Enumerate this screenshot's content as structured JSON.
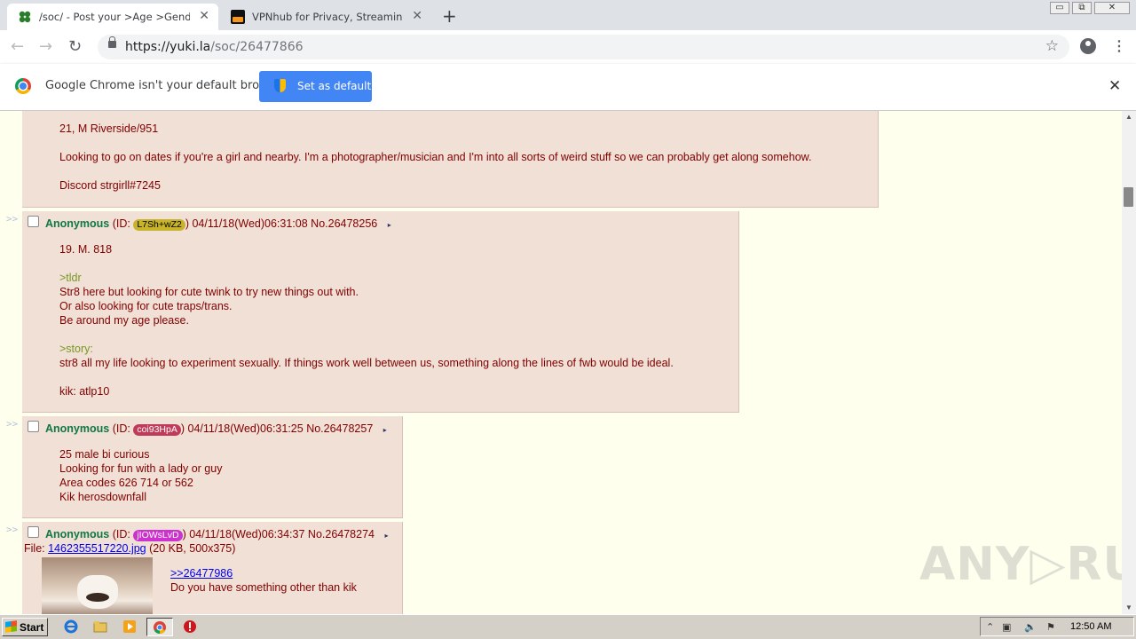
{
  "browser": {
    "tabs": [
      {
        "title": "/soc/ - Post your >Age >Gender >A",
        "close": "✕",
        "active": true
      },
      {
        "title": "VPNhub for Privacy, Streaming and f",
        "close": "✕",
        "active": false
      }
    ],
    "new_tab": "+",
    "window_controls": [
      "▭",
      "⧉",
      "✕"
    ],
    "url_host": "https://yuki.la",
    "url_path": "/soc/26477866",
    "infobar": {
      "message": "Google Chrome isn't your default browser",
      "button": "Set as default",
      "close": "✕"
    }
  },
  "posts": [
    {
      "partial": true,
      "lines": [
        "21, M Riverside/951",
        "",
        "Looking to go on dates if you're a girl and nearby. I'm a photographer/musician and I'm into all sorts of weird stuff so we can probably get along somehow.",
        "",
        "Discord strgirll#7245"
      ]
    },
    {
      "arrows": ">>",
      "name": "Anonymous",
      "id_prefix": "(ID: ",
      "id": "L7Sh+wZ2",
      "id_color": "#c8b42a",
      "id_text_color": "#000000",
      "id_suffix": ")",
      "datetime": "04/11/18(Wed)06:31:08",
      "number": "No.26478256",
      "menu": "▸",
      "line1": "19. M. 818",
      "green1": ">tldr",
      "block1": [
        "Str8 here but looking for cute twink to try new things out with.",
        "Or also looking for cute traps/trans.",
        "Be around my age please."
      ],
      "green2": ">story:",
      "line2": "str8 all my life looking to experiment sexually. If things work well between us, something along the lines of fwb would be ideal.",
      "line3": "kik: atlp10"
    },
    {
      "arrows": ">>",
      "name": "Anonymous",
      "id_prefix": "(ID: ",
      "id": "coi93HpA",
      "id_color": "#c03a5a",
      "id_text_color": "#ffffff",
      "id_suffix": ")",
      "datetime": "04/11/18(Wed)06:31:25",
      "number": "No.26478257",
      "menu": "▸",
      "lines": [
        "25 male bi curious",
        "Looking for fun with a lady or guy",
        "Area codes 626 714 or 562",
        "Kik herosdownfall"
      ]
    },
    {
      "arrows": ">>",
      "name": "Anonymous",
      "id_prefix": "(ID: ",
      "id": "jIOWsLvD",
      "id_color": "#cc33cc",
      "id_text_color": "#ffffff",
      "id_suffix": ")",
      "datetime": "04/11/18(Wed)06:34:37",
      "number": "No.26478274",
      "menu": "▸",
      "file_label": "File: ",
      "file_name": "1462355517220.jpg",
      "file_info": " (20 KB, 500x375)",
      "quote": ">>26477986",
      "text": "Do you have something other than kik"
    }
  ],
  "watermark": "ANY▷RUN",
  "taskbar": {
    "start": "Start",
    "clock": "12:50 AM"
  },
  "colors": {
    "reply_bg": "#f0e0d6",
    "page_bg": "#ffffee",
    "name": "#117743",
    "greentext": "#789922",
    "text": "#800000"
  }
}
